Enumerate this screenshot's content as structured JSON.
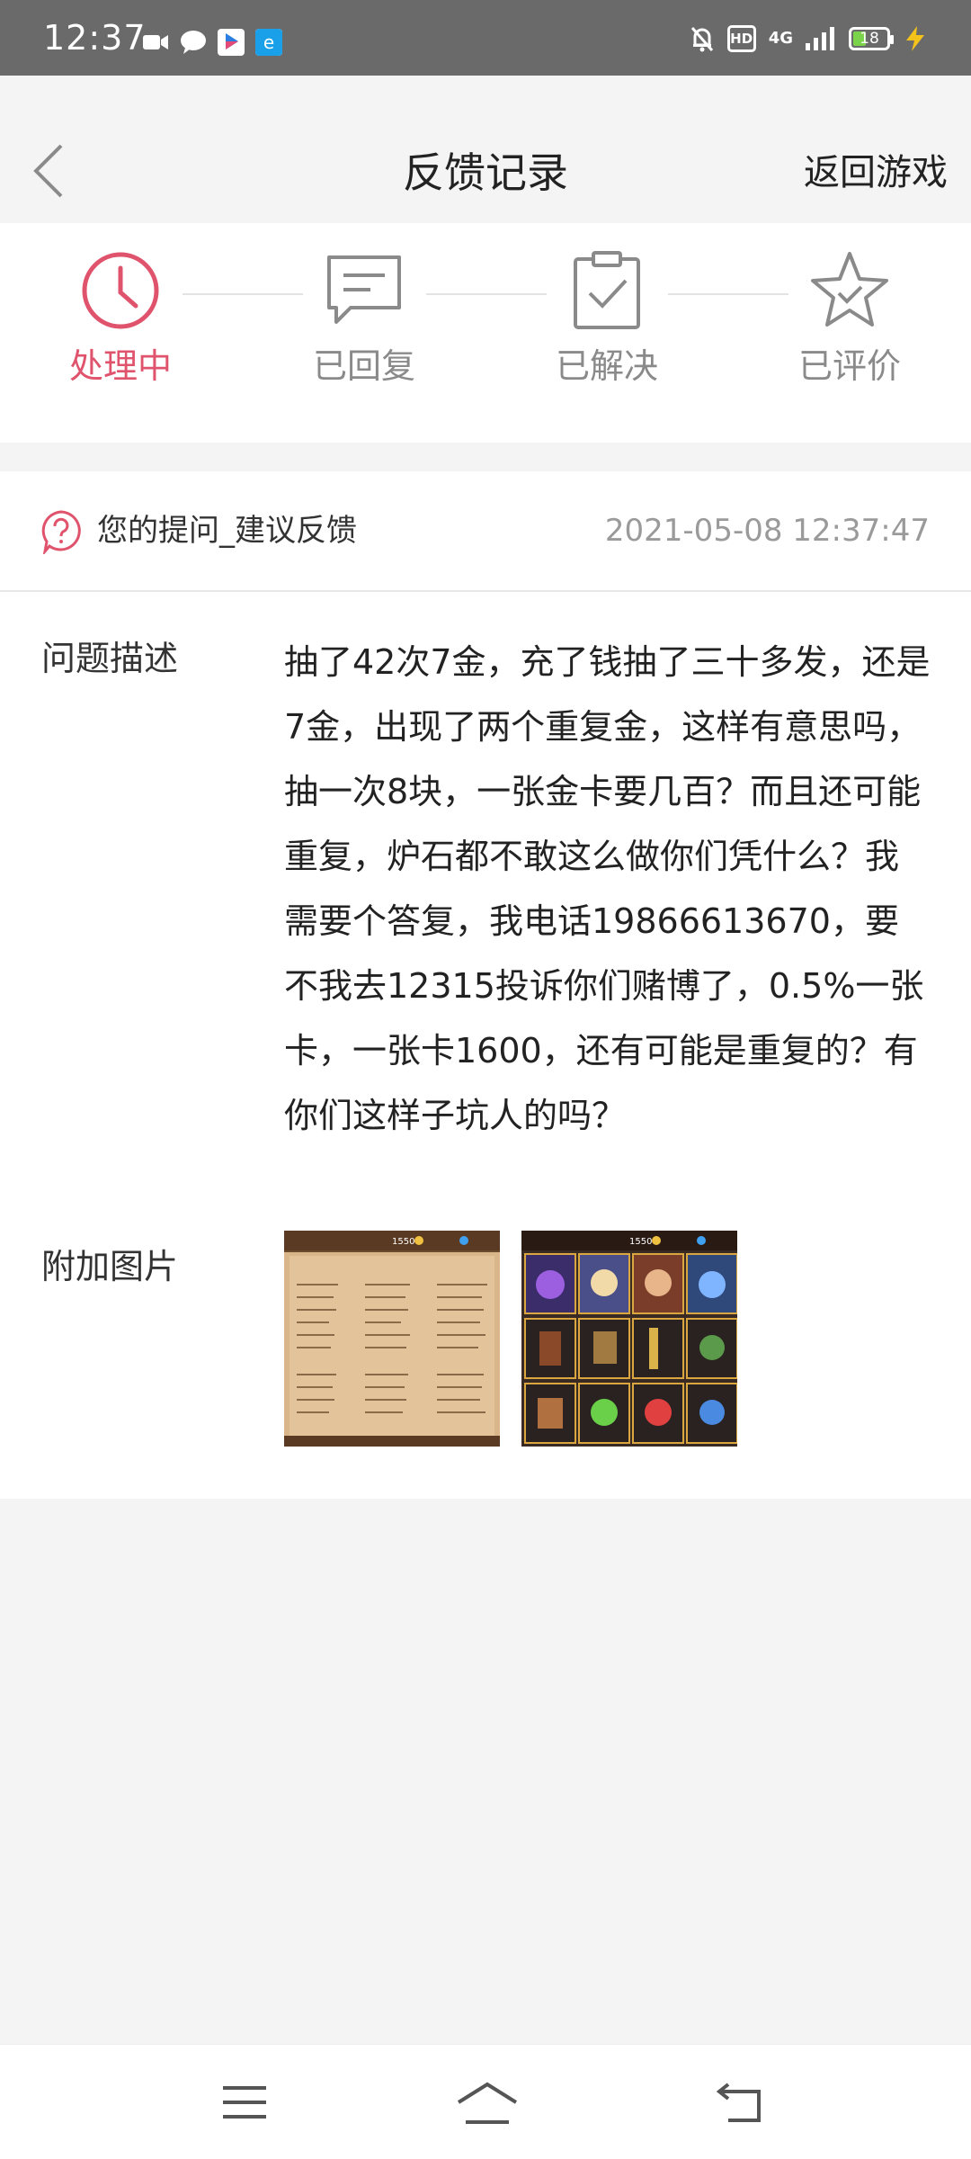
{
  "status_bar": {
    "time": "12:37",
    "hd": "HD",
    "network": "4G",
    "battery": "18"
  },
  "header": {
    "title": "反馈记录",
    "return_label": "返回游戏"
  },
  "steps": [
    {
      "label": "处理中",
      "icon": "clock-icon",
      "active": true
    },
    {
      "label": "已回复",
      "icon": "message-icon",
      "active": false
    },
    {
      "label": "已解决",
      "icon": "clipboard-check-icon",
      "active": false
    },
    {
      "label": "已评价",
      "icon": "star-check-icon",
      "active": false
    }
  ],
  "feedback": {
    "question_label": "您的提问_建议反馈",
    "timestamp": "2021-05-08 12:37:47",
    "description_label": "问题描述",
    "description": "抽了42次7金，充了钱抽了三十多发，还是7金，出现了两个重复金，这样有意思吗，抽一次8块，一张金卡要几百？而且还可能重复，炉石都不敢这么做你们凭什么？我需要个答复，我电话19866613670，要不我去12315投诉你们赌博了，0.5%一张卡，一张卡1600，还有可能是重复的？有你们这样子坑人的吗？",
    "images_label": "附加图片",
    "thumb1_top": "1550",
    "thumb2_top": "1550"
  },
  "colors": {
    "accent": "#e0536c",
    "inactive": "#8a8a8a",
    "status_bar": "#6a6a6a"
  }
}
